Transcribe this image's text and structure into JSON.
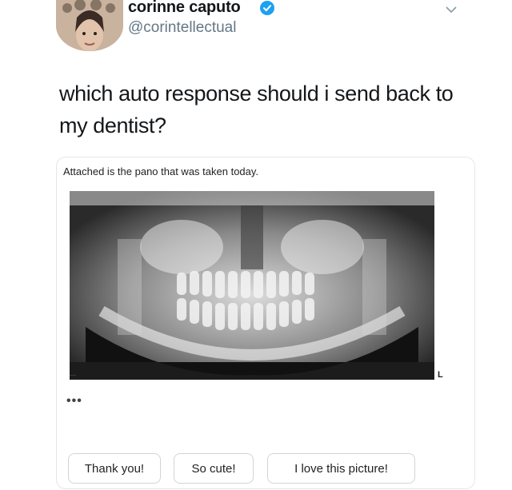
{
  "tweet": {
    "display_name": "corinne caputo",
    "handle": "@corintellectual",
    "verified_icon": "verified-badge-icon",
    "text": "which auto response should i send back to my dentist?"
  },
  "email": {
    "body_line": "Attached is the pano that was taken today.",
    "image_marker": "L",
    "more_dots": "•••",
    "smart_replies": [
      "Thank you!",
      "So cute!",
      "I love this picture!"
    ]
  },
  "colors": {
    "verified_blue": "#1da1f2",
    "handle_gray": "#657786"
  }
}
